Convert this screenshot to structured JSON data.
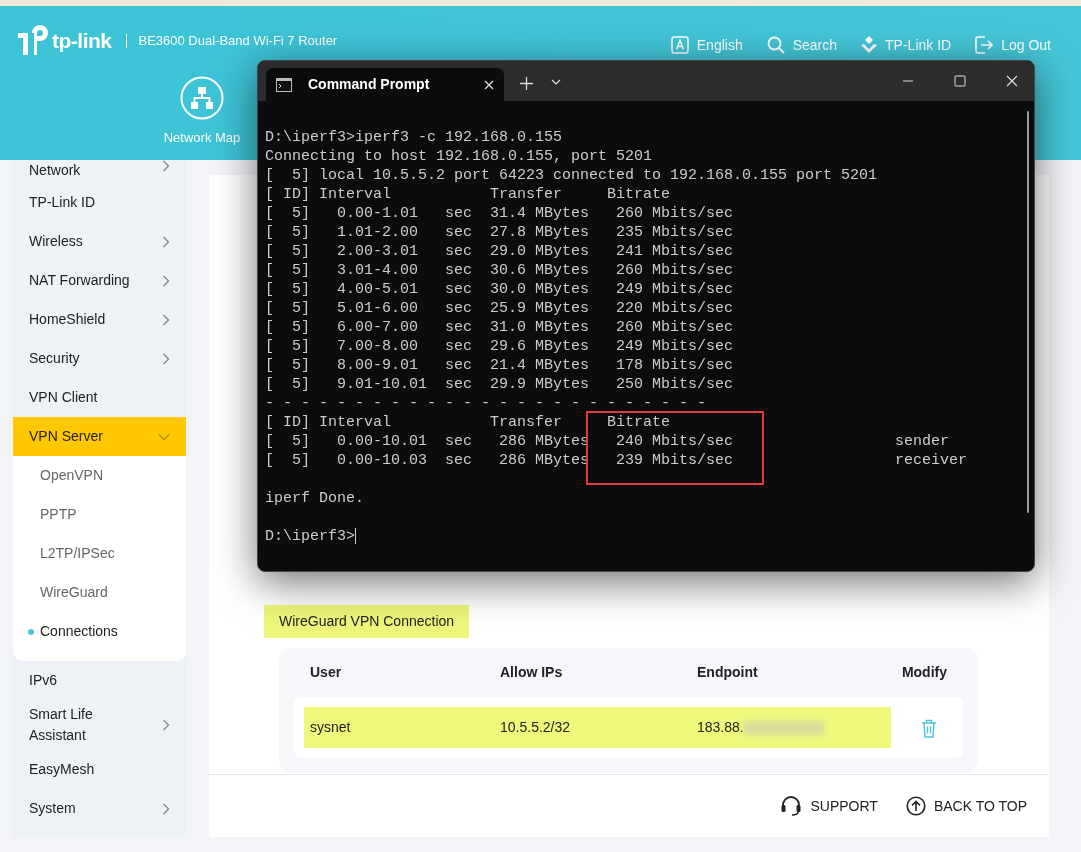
{
  "header": {
    "brand": "tp-link",
    "model": "BE3600 Dual-Band Wi-Fi 7 Router",
    "links": [
      {
        "label": "English",
        "kind": "language"
      },
      {
        "label": "Search",
        "kind": "search"
      },
      {
        "label": "TP-Link ID",
        "kind": "account"
      },
      {
        "label": "Log Out",
        "kind": "logout"
      }
    ],
    "nav": [
      {
        "label": "Network Map",
        "kind": "network"
      }
    ]
  },
  "sidebar": {
    "items": [
      {
        "label": "Network",
        "has_submenu": true,
        "expanded": false,
        "selected": false
      },
      {
        "label": "TP-Link ID",
        "has_submenu": false,
        "selected": false
      },
      {
        "label": "Wireless",
        "has_submenu": true,
        "expanded": false,
        "selected": false
      },
      {
        "label": "NAT Forwarding",
        "has_submenu": true,
        "expanded": false,
        "selected": false
      },
      {
        "label": "HomeShield",
        "has_submenu": true,
        "expanded": false,
        "selected": false
      },
      {
        "label": "Security",
        "has_submenu": true,
        "expanded": false,
        "selected": false
      },
      {
        "label": "VPN Client",
        "has_submenu": false,
        "selected": false
      },
      {
        "label": "VPN Server",
        "has_submenu": true,
        "expanded": true,
        "selected": true,
        "children": [
          {
            "label": "OpenVPN",
            "selected": false
          },
          {
            "label": "PPTP",
            "selected": false
          },
          {
            "label": "L2TP/IPSec",
            "selected": false
          },
          {
            "label": "WireGuard",
            "selected": false
          },
          {
            "label": "Connections",
            "selected": true
          }
        ]
      },
      {
        "label": "IPv6",
        "has_submenu": false,
        "selected": false
      },
      {
        "label": "Smart Life Assistant",
        "has_submenu": true,
        "expanded": false,
        "selected": false
      },
      {
        "label": "EasyMesh",
        "has_submenu": false,
        "selected": false
      },
      {
        "label": "System",
        "has_submenu": true,
        "expanded": false,
        "selected": false
      }
    ]
  },
  "content": {
    "section_title": "WireGuard VPN Connection",
    "table": {
      "columns": [
        "User",
        "Allow IPs",
        "Endpoint",
        "Modify"
      ],
      "rows": [
        {
          "user": "sysnet",
          "allow_ips": "10.5.5.2/32",
          "endpoint": "183.88.",
          "endpoint_redacted": true
        }
      ]
    }
  },
  "footer": {
    "links": [
      {
        "label": "SUPPORT",
        "kind": "support"
      },
      {
        "label": "BACK TO TOP",
        "kind": "top"
      }
    ]
  },
  "terminal": {
    "title": "Command Prompt",
    "blocks": [
      [
        "D:\\iperf3>iperf3 -c 192.168.0.155",
        "Connecting to host 192.168.0.155, port 5201",
        "[  5] local 10.5.5.2 port 64223 connected to 192.168.0.155 port 5201",
        "[ ID] Interval           Transfer     Bitrate",
        "[  5]   0.00-1.01   sec  31.4 MBytes   260 Mbits/sec",
        "[  5]   1.01-2.00   sec  27.8 MBytes   235 Mbits/sec",
        "[  5]   2.00-3.01   sec  29.0 MBytes   241 Mbits/sec",
        "[  5]   3.01-4.00   sec  30.6 MBytes   260 Mbits/sec",
        "[  5]   4.00-5.01   sec  30.0 MBytes   249 Mbits/sec",
        "[  5]   5.01-6.00   sec  25.9 MBytes   220 Mbits/sec",
        "[  5]   6.00-7.00   sec  31.0 MBytes   260 Mbits/sec",
        "[  5]   7.00-8.00   sec  29.6 MBytes   249 Mbits/sec",
        "[  5]   8.00-9.01   sec  21.4 MBytes   178 Mbits/sec",
        "[  5]   9.01-10.01  sec  29.9 MBytes   250 Mbits/sec",
        "- - - - - - - - - - - - - - - - - - - - - - - - -",
        "[ ID] Interval           Transfer     Bitrate",
        "[  5]   0.00-10.01  sec   286 MBytes   240 Mbits/sec                  sender",
        "[  5]   0.00-10.03  sec   286 MBytes   239 Mbits/sec                  receiver"
      ],
      [
        "iperf Done."
      ],
      [
        "D:\\iperf3>"
      ]
    ]
  }
}
